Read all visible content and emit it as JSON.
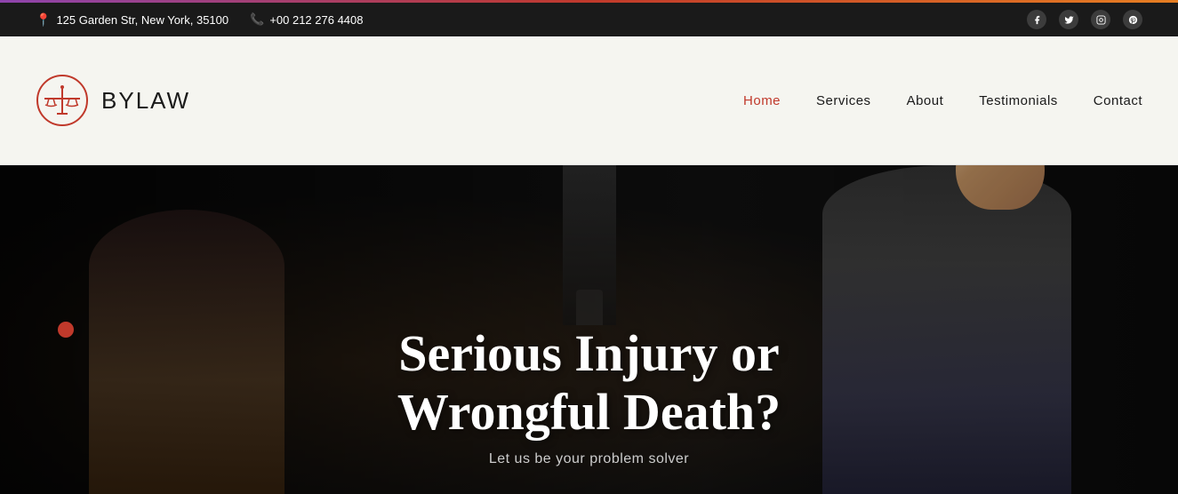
{
  "topbar": {
    "address": "125 Garden Str, New York, 35100",
    "phone": "+00 212 276 4408",
    "address_icon": "📍",
    "phone_icon": "📞"
  },
  "social": {
    "facebook": "f",
    "twitter": "t",
    "instagram": "i",
    "pinterest": "p"
  },
  "header": {
    "logo_text_bold": "BY",
    "logo_text_light": "LAW",
    "nav_items": [
      {
        "label": "Home",
        "active": true
      },
      {
        "label": "Services",
        "active": false
      },
      {
        "label": "About",
        "active": false
      },
      {
        "label": "Testimonials",
        "active": false
      },
      {
        "label": "Contact",
        "active": false
      }
    ]
  },
  "hero": {
    "title_line1": "Serious Injury or",
    "title_line2": "Wrongful Death?",
    "subtitle": "Let us be your problem solver"
  },
  "colors": {
    "accent": "#c0392b",
    "dark": "#1a1a1a",
    "light_bg": "#f5f5f0",
    "white": "#ffffff",
    "nav_active": "#c0392b"
  }
}
